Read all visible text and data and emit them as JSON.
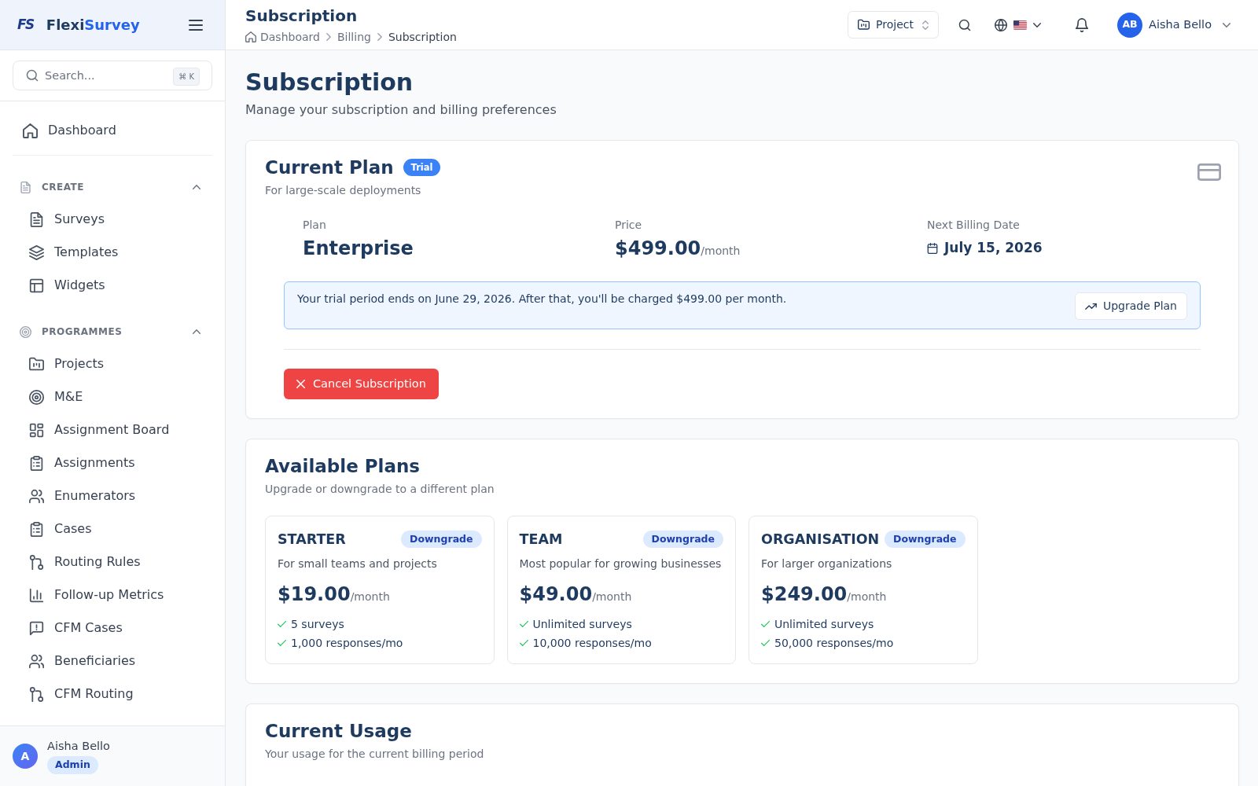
{
  "sidebar": {
    "brand": {
      "logo": "FS",
      "primary": "Flexi",
      "accent": "Survey"
    },
    "search": {
      "placeholder": "Search...",
      "shortcut": "⌘ K"
    },
    "top_items": [
      {
        "label": "Dashboard",
        "selected": false
      }
    ],
    "sections": [
      {
        "title": "CREATE",
        "expanded": true,
        "items": [
          {
            "label": "Surveys",
            "selected": false
          },
          {
            "label": "Templates",
            "selected": false
          },
          {
            "label": "Widgets",
            "selected": false
          }
        ]
      },
      {
        "title": "PROGRAMMES",
        "expanded": true,
        "items": [
          {
            "label": "Projects",
            "selected": false
          },
          {
            "label": "M&E",
            "selected": false
          },
          {
            "label": "Assignment Board",
            "selected": false
          },
          {
            "label": "Assignments",
            "selected": false
          },
          {
            "label": "Enumerators",
            "selected": false
          },
          {
            "label": "Cases",
            "selected": false
          },
          {
            "label": "Routing Rules",
            "selected": false
          },
          {
            "label": "Follow-up Metrics",
            "selected": false
          },
          {
            "label": "CFM Cases",
            "selected": false
          },
          {
            "label": "Beneficiaries",
            "selected": false
          },
          {
            "label": "CFM Routing",
            "selected": false
          }
        ]
      }
    ],
    "user": {
      "initial": "A",
      "name": "Aisha Bello",
      "role": "Admin"
    }
  },
  "header": {
    "title": "Subscription",
    "breadcrumb": [
      {
        "label": "Dashboard",
        "current": false
      },
      {
        "label": "Billing",
        "current": false
      },
      {
        "label": "Subscription",
        "current": true
      }
    ],
    "project_button": "Project",
    "user": {
      "initials": "AB",
      "name": "Aisha Bello"
    }
  },
  "page": {
    "title": "Subscription",
    "subtitle": "Manage your subscription and billing preferences"
  },
  "current_plan": {
    "title": "Current Plan",
    "badge": "Trial",
    "subtitle": "For large-scale deployments",
    "stats": [
      {
        "kind": "text",
        "label": "Plan",
        "value": "Enterprise"
      },
      {
        "kind": "price",
        "label": "Price",
        "value": "$499.00",
        "unit": "/month"
      },
      {
        "kind": "date",
        "label": "Next Billing Date",
        "value": "July 15, 2026"
      }
    ],
    "notice": {
      "text": "Your trial period ends on June 29, 2026. After that, you'll be charged $499.00 per month.",
      "button": "Upgrade Plan"
    },
    "cancel_button": "Cancel Subscription"
  },
  "available_plans": {
    "title": "Available Plans",
    "subtitle": "Upgrade or downgrade to a different plan",
    "plans": [
      {
        "name": "STARTER",
        "action": "Downgrade",
        "description": "For small teams and projects",
        "price": "$19.00",
        "unit": "/month",
        "features": [
          "5 surveys",
          "1,000 responses/mo"
        ]
      },
      {
        "name": "TEAM",
        "action": "Downgrade",
        "description": "Most popular for growing businesses",
        "price": "$49.00",
        "unit": "/month",
        "features": [
          "Unlimited surveys",
          "10,000 responses/mo"
        ]
      },
      {
        "name": "ORGANISATION",
        "action": "Downgrade",
        "description": "For larger organizations",
        "price": "$249.00",
        "unit": "/month",
        "features": [
          "Unlimited surveys",
          "50,000 responses/mo"
        ]
      }
    ]
  },
  "current_usage": {
    "title": "Current Usage",
    "subtitle": "Your usage for the current billing period"
  }
}
